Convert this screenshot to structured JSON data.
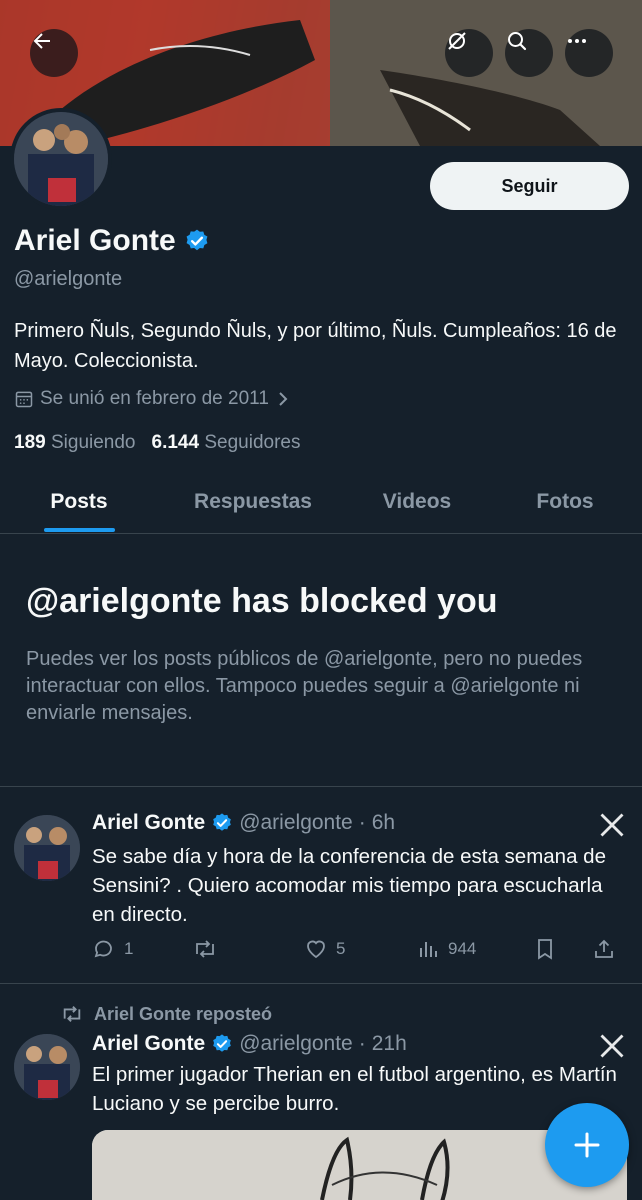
{
  "header": {
    "back_icon": "arrow-left-icon",
    "grok_icon": "grok-icon",
    "search_icon": "search-icon",
    "more_icon": "more-horizontal-icon"
  },
  "profile": {
    "name": "Ariel Gonte",
    "handle": "@arielgonte",
    "follow_label": "Seguir",
    "bio": "Primero Ñuls, Segundo Ñuls, y por último, Ñuls. Cumpleaños: 16 de Mayo. Coleccionista.",
    "joined": "Se unió en febrero de 2011",
    "following_count": "189",
    "following_label": "Siguiendo",
    "followers_count": "6.144",
    "followers_label": "Seguidores"
  },
  "tabs": [
    {
      "label": "Posts",
      "active": true
    },
    {
      "label": "Respuestas",
      "active": false
    },
    {
      "label": "Videos",
      "active": false
    },
    {
      "label": "Fotos",
      "active": false
    }
  ],
  "blocked": {
    "title": "@arielgonte has blocked you",
    "message": "Puedes ver los posts públicos de @arielgonte, pero no puedes interactuar con ellos. Tampoco puedes seguir a @arielgonte ni enviarle mensajes."
  },
  "posts": [
    {
      "name": "Ariel Gonte",
      "handle": "@arielgonte",
      "time": "6h",
      "text": "Se sabe día y hora de la conferencia de esta semana de Sensini? . Quiero acomodar mis tiempo para escucharla en directo.",
      "replies": "1",
      "reposts": "",
      "likes": "5",
      "views": "944"
    },
    {
      "repost_label": "Ariel Gonte reposteó",
      "name": "Ariel Gonte",
      "handle": "@arielgonte",
      "time": "21h",
      "text": "El primer jugador Therian en el futbol argentino, es Martín Luciano y se percibe burro."
    }
  ],
  "colors": {
    "background": "#15202b",
    "accent": "#1d9bf0",
    "secondary_text": "#8b98a5",
    "divider": "#38444d"
  }
}
